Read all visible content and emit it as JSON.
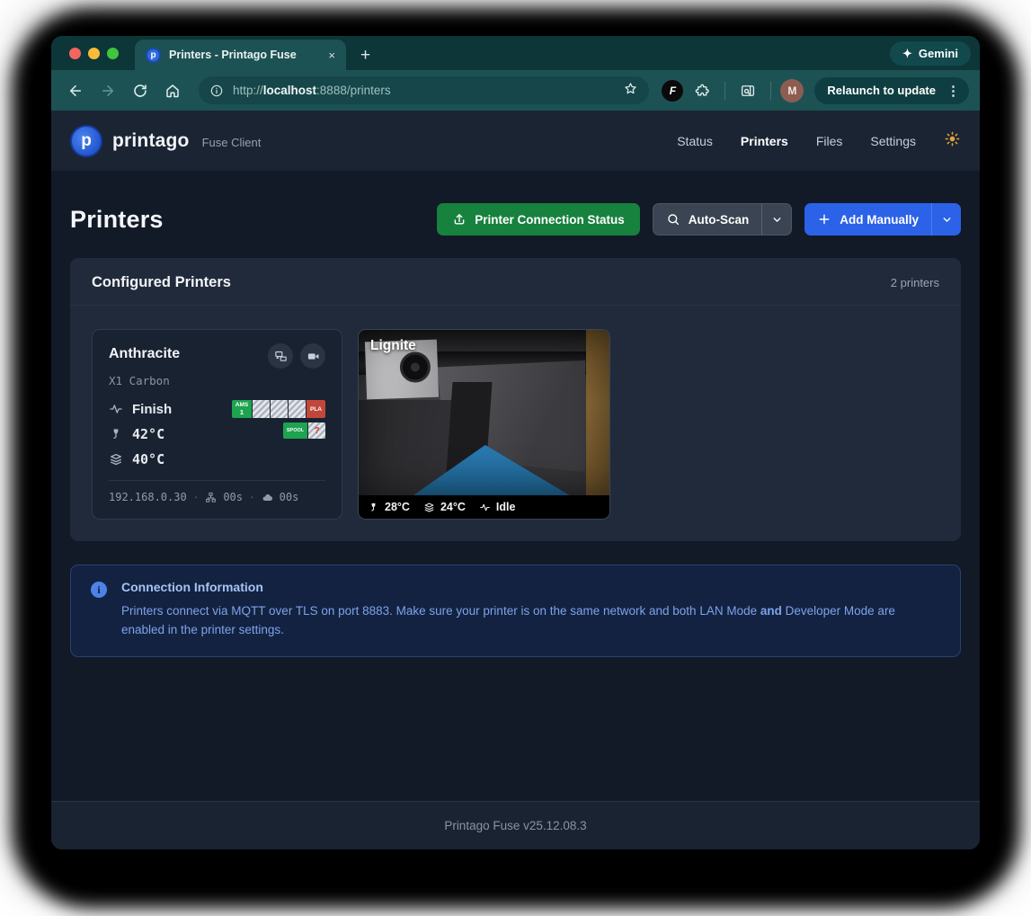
{
  "browser": {
    "tab_title": "Printers - Printago Fuse",
    "new_tab_glyph": "+",
    "close_glyph": "×",
    "gemini_label": "Gemini",
    "sparkle_glyph": "✦",
    "url": {
      "prefix": "http://",
      "host": "localhost",
      "rest": ":8888/printers"
    },
    "extension_initial": "F",
    "avatar_initial": "M",
    "relaunch_label": "Relaunch to update",
    "menu_glyph": "⋮"
  },
  "header": {
    "brand": "printago",
    "brand_initial": "p",
    "subtitle": "Fuse Client",
    "nav": [
      {
        "label": "Status"
      },
      {
        "label": "Printers"
      },
      {
        "label": "Files"
      },
      {
        "label": "Settings"
      }
    ]
  },
  "page": {
    "title": "Printers",
    "connection_status_label": "Printer Connection Status",
    "auto_scan_label": "Auto-Scan",
    "add_manually_label": "Add Manually"
  },
  "panel": {
    "title": "Configured Printers",
    "count": "2 printers"
  },
  "printer_card": {
    "name": "Anthracite",
    "model": "X1 Carbon",
    "status": "Finish",
    "nozzle_temp": "42°C",
    "bed_temp": "40°C",
    "ams": {
      "label": "AMS",
      "number": "1",
      "material": "PLA"
    },
    "spool": {
      "label": "SPOOL",
      "unknown": "?"
    },
    "ip": "192.168.0.30",
    "lan_time": "00s",
    "cloud_time": "00s",
    "sep": "·"
  },
  "camera_card": {
    "name": "Lignite",
    "nozzle_temp": "28°C",
    "bed_temp": "24°C",
    "status": "Idle"
  },
  "banner": {
    "info_glyph": "i",
    "title": "Connection Information",
    "text_1": "Printers connect via MQTT over TLS on port 8883. Make sure your printer is on the same network and both LAN Mode ",
    "text_bold": "and",
    "text_2": " Developer Mode are enabled in the printer settings."
  },
  "footer": {
    "version": "Printago Fuse v25.12.08.3"
  },
  "icons": [
    "back-icon",
    "forward-icon",
    "reload-icon",
    "home-icon",
    "info-icon",
    "star-icon",
    "extension-icon",
    "puzzle-icon",
    "side-panel-search-icon",
    "menu-dots-icon",
    "sparkle-icon",
    "sun-icon",
    "search-icon",
    "chevron-down-icon",
    "plus-icon",
    "upload-icon",
    "screens-icon",
    "video-camera-icon",
    "pulse-icon",
    "nozzle-icon",
    "layers-icon",
    "lan-icon",
    "cloud-icon"
  ],
  "colors": {
    "chrome_teal": "#1d5254",
    "chrome_dark": "#0d3638",
    "page_bg": "#121927",
    "panel_bg": "#202a3a",
    "card_bg": "#192231",
    "accent_green": "#17813e",
    "accent_blue": "#2b62e8",
    "banner_bg": "#132240",
    "banner_text": "#7da3ea",
    "ams_green": "#1ea350",
    "pla_red": "#c2473a",
    "sun_yellow": "#e2a33c"
  }
}
